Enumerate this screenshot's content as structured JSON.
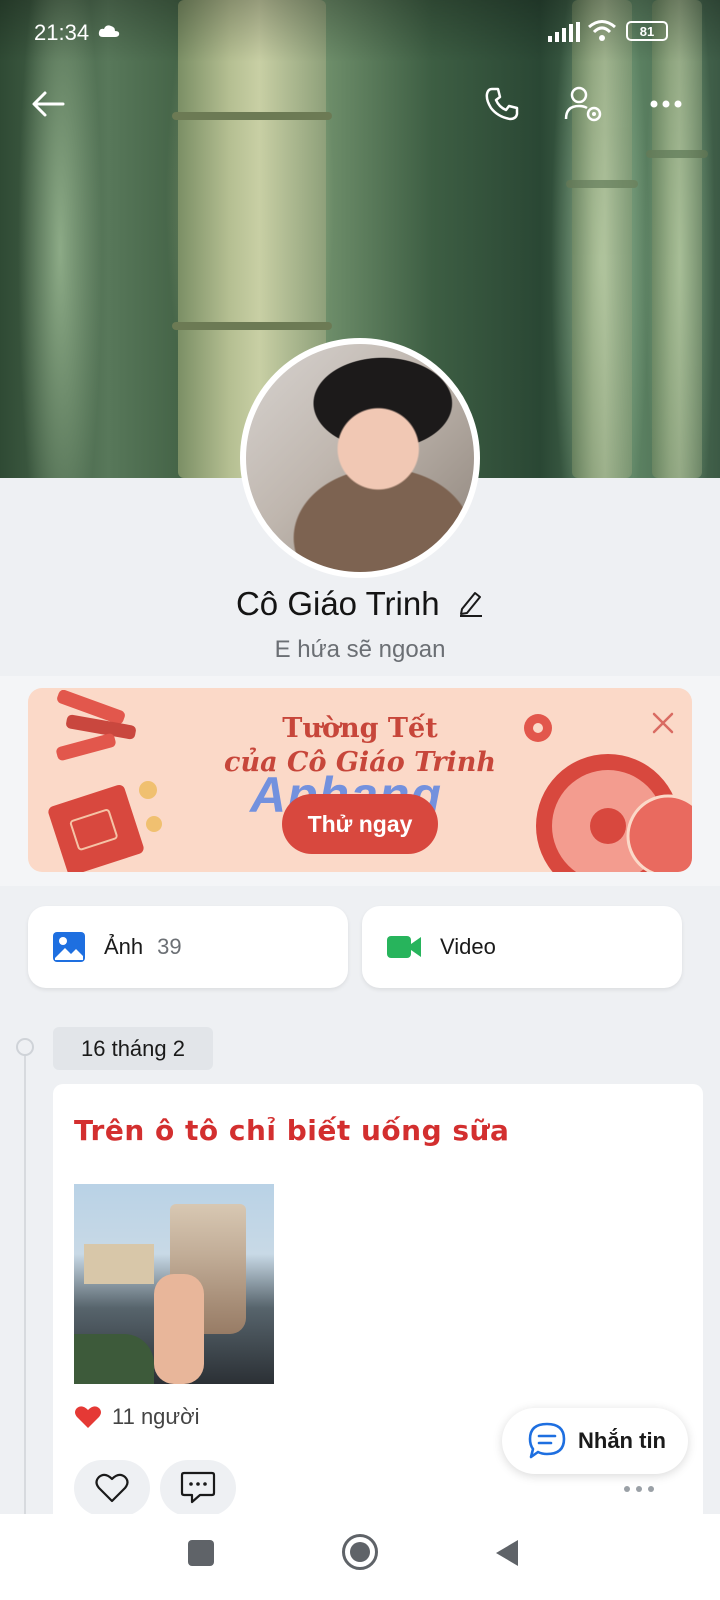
{
  "status_bar": {
    "time": "21:34",
    "battery": "81"
  },
  "profile": {
    "name": "Cô Giáo Trinh",
    "status": "E hứa sẽ ngoan"
  },
  "banner": {
    "line1": "Tường Tết",
    "line2": "của Cô Giáo Trinh",
    "button_label": "Thử ngay",
    "watermark": "Aphang"
  },
  "media": {
    "photos_label": "Ảnh",
    "photos_count": "39",
    "video_label": "Video"
  },
  "timeline": {
    "date": "16 tháng 2",
    "post": {
      "title": "Trên ô tô chỉ biết uống sữa",
      "likes": "11 người"
    }
  },
  "message_button": {
    "label": "Nhắn tin"
  },
  "colors": {
    "accent_red": "#d32f2f",
    "brand_blue": "#1e6fe0",
    "video_green": "#27b45c"
  }
}
